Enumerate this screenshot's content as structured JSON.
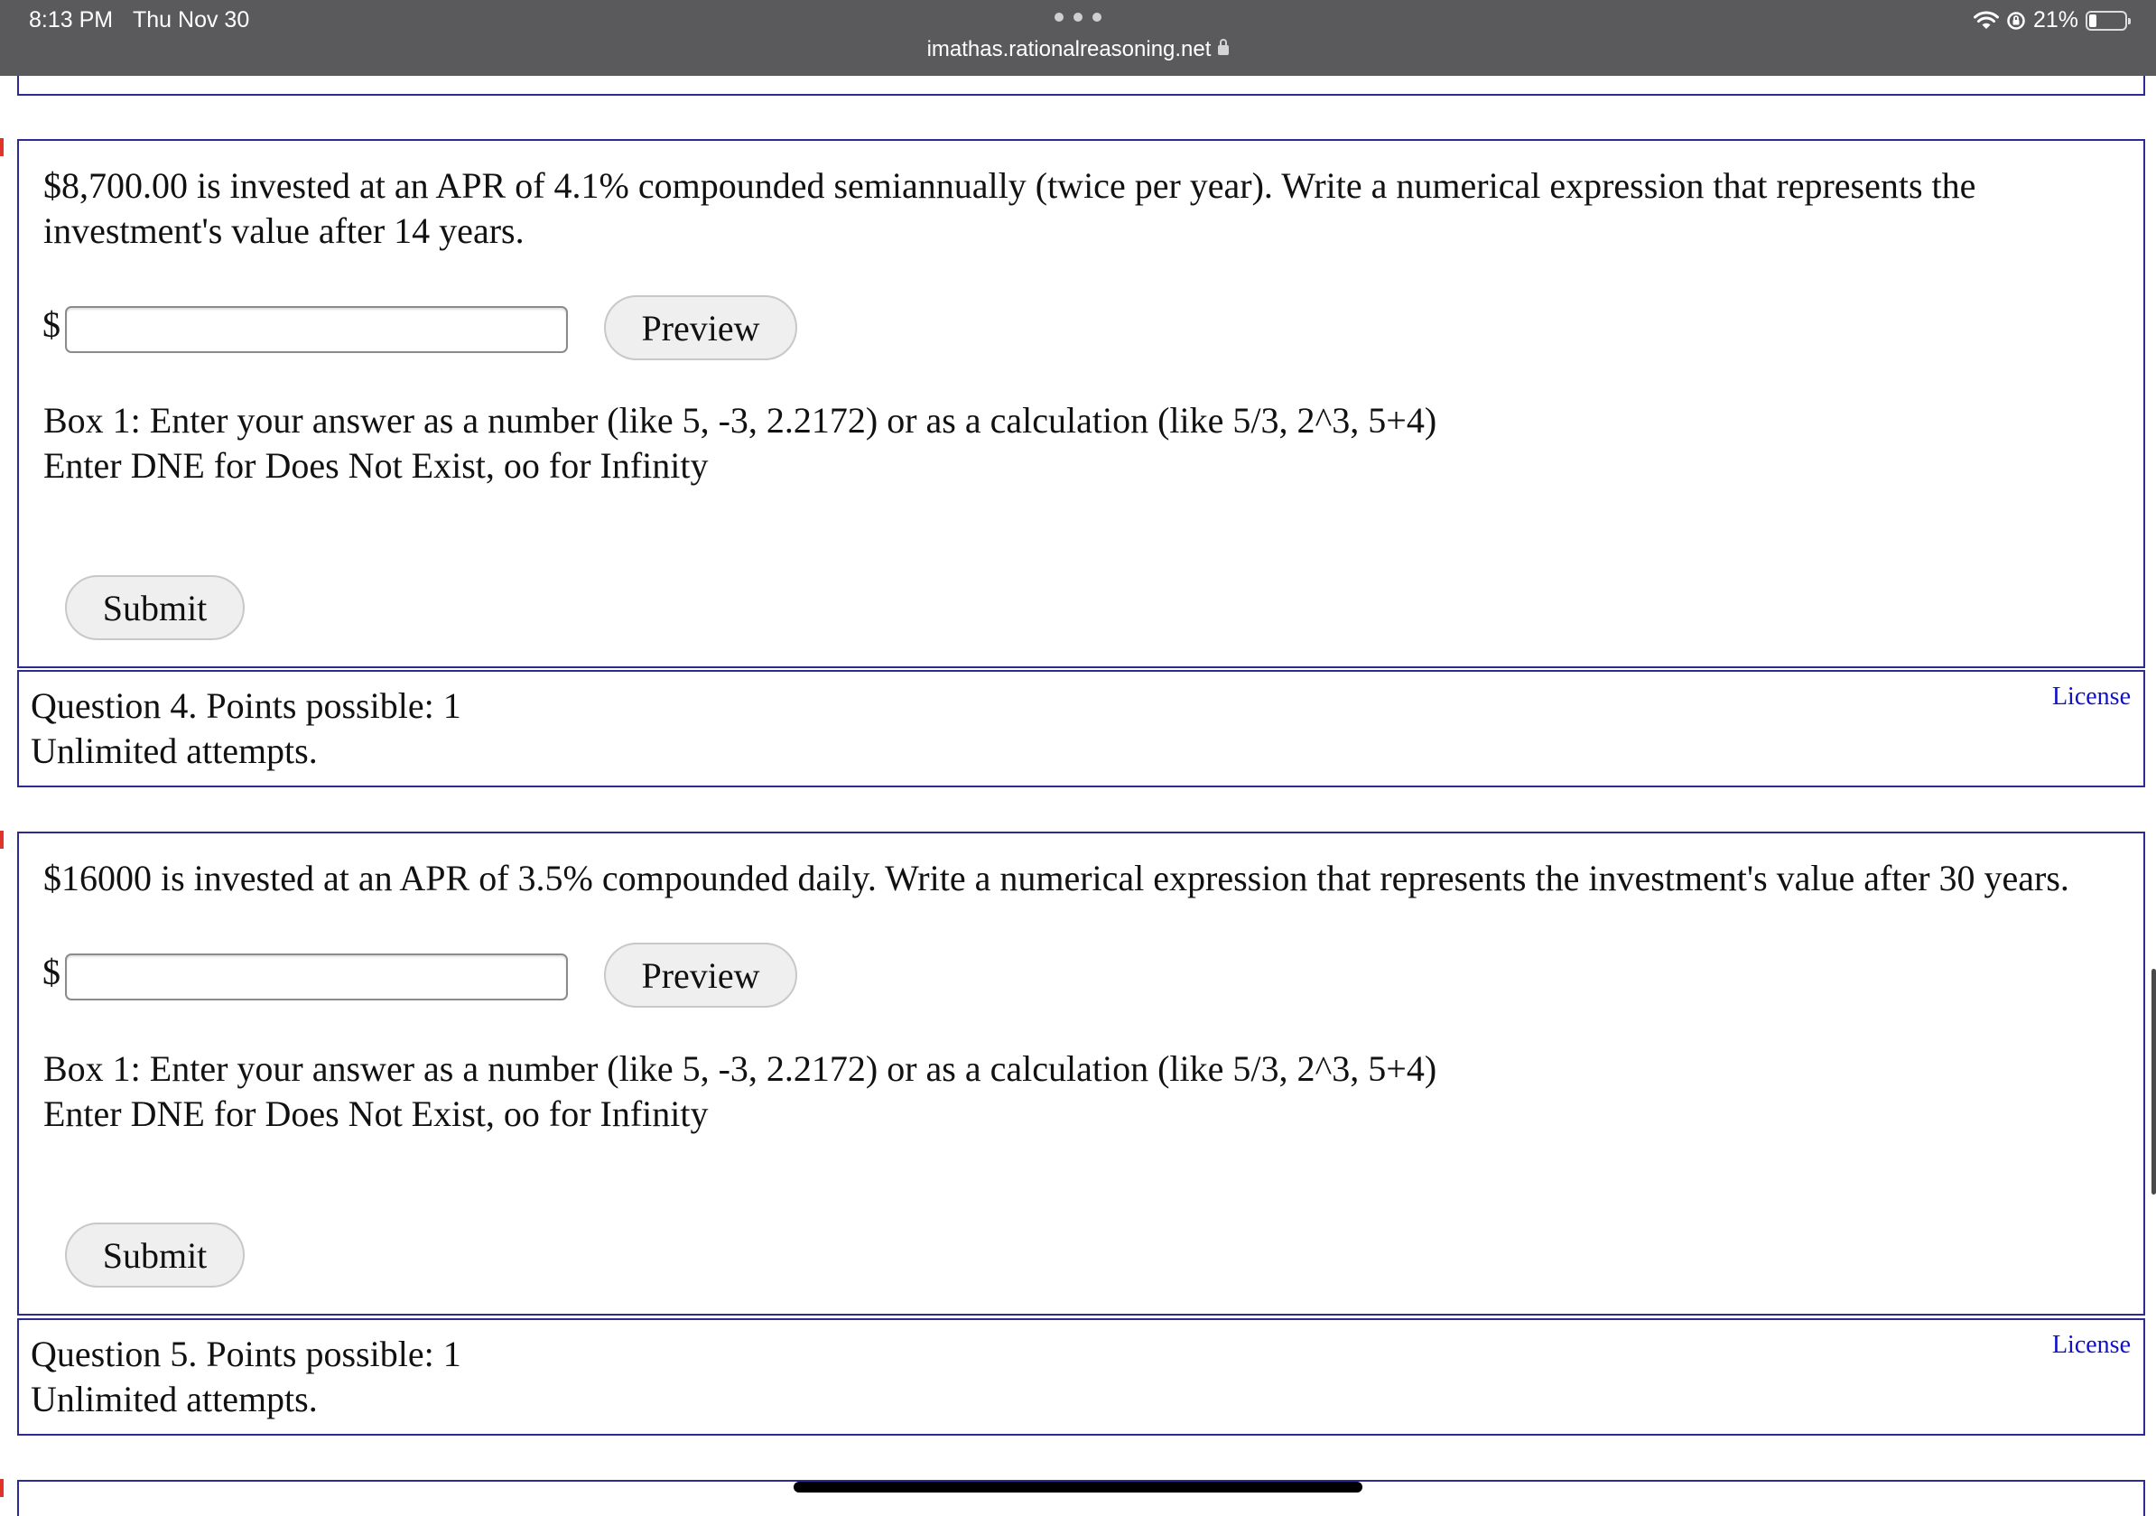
{
  "status_bar": {
    "time": "8:13 PM",
    "date": "Thu Nov 30",
    "url": "imathas.rationalreasoning.net",
    "battery": "21%"
  },
  "question3": {
    "text": "$8,700.00 is invested at an APR of 4.1% compounded semiannually (twice per year). Write a numerical expression that represents the investment's value after 14 years.",
    "currency_symbol": "$",
    "input_value": "",
    "preview_label": "Preview",
    "hint_line1": "Box 1: Enter your answer as a number (like 5, -3, 2.2172) or as a calculation (like 5/3, 2^3, 5+4)",
    "hint_line2": "Enter DNE for Does Not Exist, oo for Infinity",
    "submit_label": "Submit"
  },
  "question4_info": {
    "title": "Question 4. Points possible: 1",
    "attempts": "Unlimited attempts.",
    "license": "License"
  },
  "question4": {
    "text": "$16000 is invested at an APR of 3.5% compounded daily. Write a numerical expression that represents the investment's value after 30 years.",
    "currency_symbol": "$",
    "input_value": "",
    "preview_label": "Preview",
    "hint_line1": "Box 1: Enter your answer as a number (like 5, -3, 2.2172) or as a calculation (like 5/3, 2^3, 5+4)",
    "hint_line2": "Enter DNE for Does Not Exist, oo for Infinity",
    "submit_label": "Submit"
  },
  "question5_info": {
    "title": "Question 5. Points possible: 1",
    "attempts": "Unlimited attempts.",
    "license": "License"
  },
  "colors": {
    "box_border": "#2b2b92",
    "link": "#1010cc",
    "marker": "#e0342a",
    "status_bar": "#5a5a5c"
  }
}
